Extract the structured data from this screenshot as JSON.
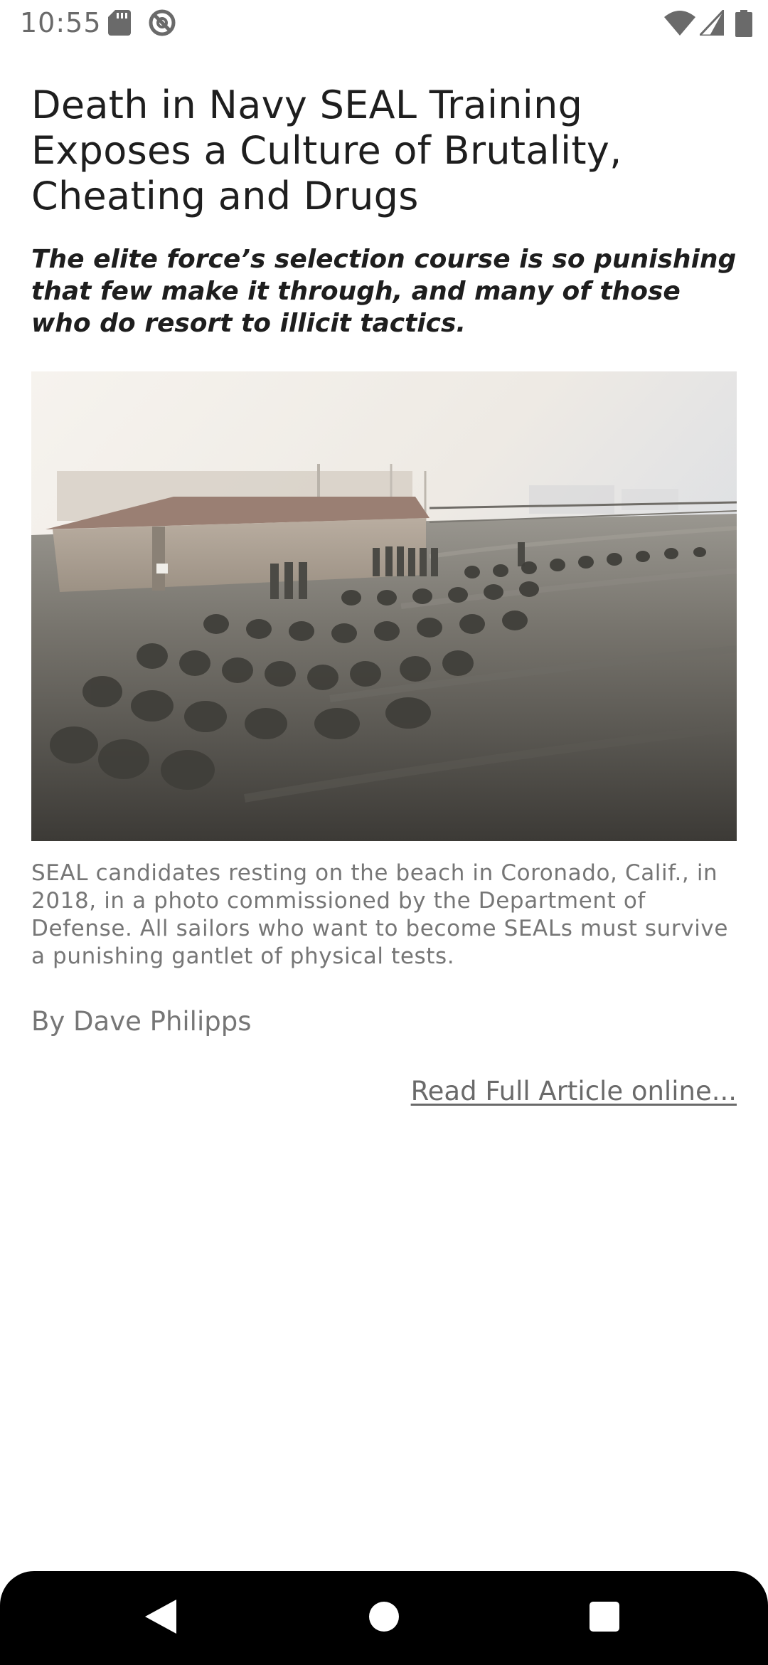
{
  "status_bar": {
    "time": "10:55",
    "icons": [
      "sd-card-icon",
      "nfc-icon",
      "wifi-icon",
      "cell-signal-icon",
      "battery-icon"
    ]
  },
  "article": {
    "headline": "Death in Navy SEAL Training Exposes a Culture of Brutality, Cheating and Drugs",
    "dek": "The elite force’s selection course is so punishing that few make it through, and many of those who do resort to illicit tactics.",
    "caption": "SEAL candidates resting on the beach in Coronado, Calif., in 2018, in a photo commissioned by the Department of Defense. All sailors who want to become SEALs must survive a punishing gantlet of physical tests.",
    "byline": "By Dave Philipps",
    "read_more_label": "Read Full Article online..."
  },
  "nav_bar": {
    "icons": [
      "back-icon",
      "home-icon",
      "recents-icon"
    ]
  },
  "colors": {
    "text_primary": "#1e1e1e",
    "text_secondary": "#767676",
    "nav_background": "#000000"
  }
}
